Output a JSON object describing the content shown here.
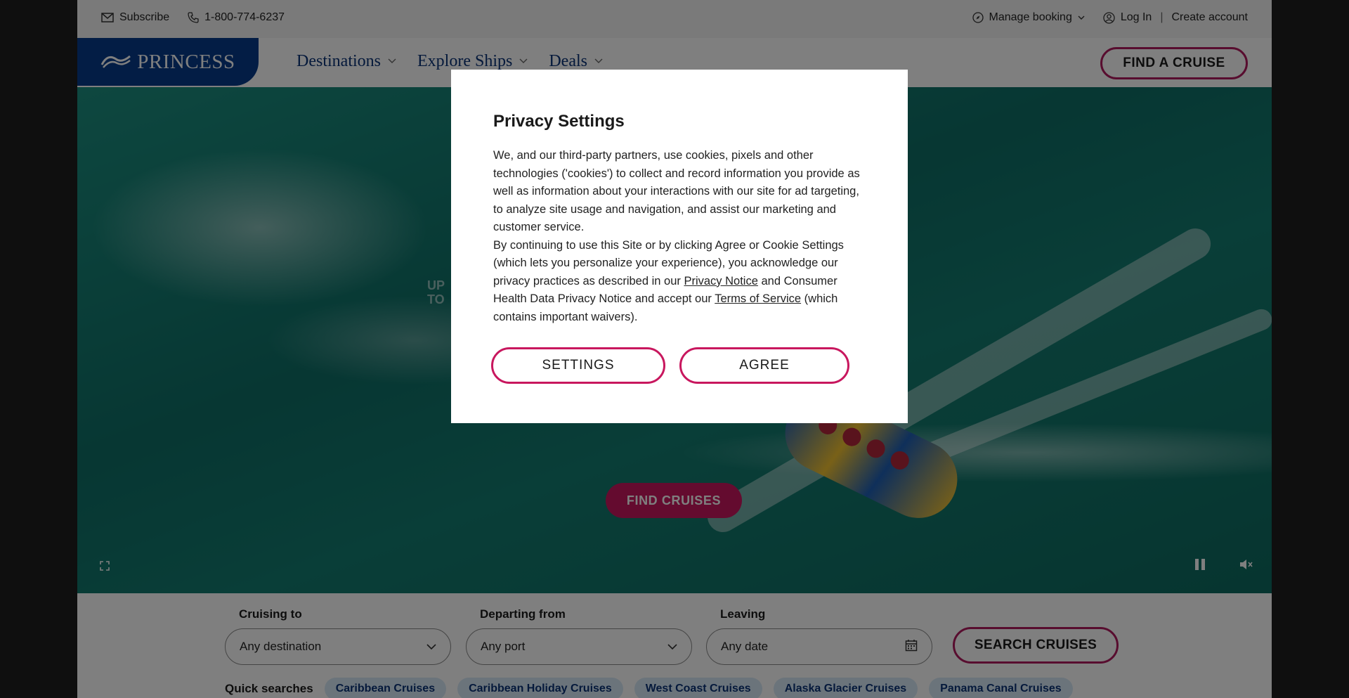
{
  "utility": {
    "subscribe": "Subscribe",
    "phone": "1-800-774-6237",
    "manage_booking": "Manage booking",
    "log_in": "Log In",
    "separator": "|",
    "create_account": "Create account"
  },
  "header": {
    "logo": "PRINCESS",
    "nav": [
      {
        "label": "Destinations"
      },
      {
        "label": "Explore Ships"
      },
      {
        "label": "Deals"
      }
    ],
    "find_cruise": "FIND A CRUISE"
  },
  "hero": {
    "ghost_text_1": "UP",
    "ghost_text_2": "TO",
    "cta": "FIND CRUISES"
  },
  "search": {
    "cruising_to_label": "Cruising to",
    "cruising_to_value": "Any destination",
    "departing_from_label": "Departing from",
    "departing_from_value": "Any port",
    "leaving_label": "Leaving",
    "leaving_value": "Any date",
    "search_button": "SEARCH CRUISES",
    "quick_label": "Quick searches",
    "quick_chips": [
      "Caribbean Cruises",
      "Caribbean Holiday Cruises",
      "West Coast Cruises",
      "Alaska Glacier Cruises",
      "Panama Canal Cruises"
    ]
  },
  "modal": {
    "title": "Privacy Settings",
    "para1": "We, and our third-party partners, use cookies, pixels and other technologies ('cookies') to collect and record information you provide as well as information about your interactions with our site for ad targeting, to analyze site usage and navigation, and assist our marketing and customer service.",
    "para2_a": "By continuing to use this Site or by clicking Agree or Cookie Settings (which lets you personalize your experience), you acknowledge our privacy practices as described in our ",
    "privacy_notice": "Privacy Notice",
    "para2_b": " and Consumer Health Data Privacy Notice and accept our ",
    "terms": "Terms of Service",
    "para2_c": " (which contains important waivers).",
    "settings_button": "SETTINGS",
    "agree_button": "AGREE"
  },
  "colors": {
    "brand_blue": "#063b8a",
    "accent_magenta": "#c8175e",
    "chip_bg": "#d6e9f6"
  }
}
